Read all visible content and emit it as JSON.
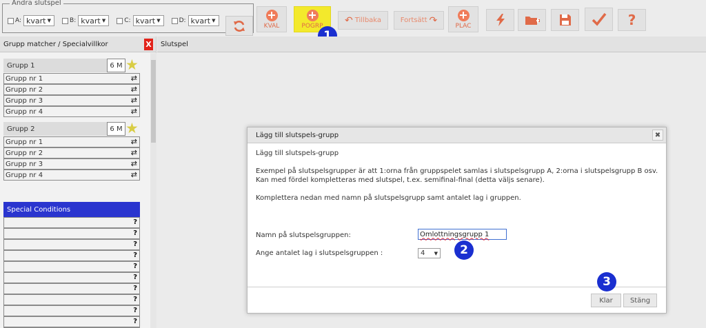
{
  "toolbar": {
    "legend": "Ändra slutspel",
    "slots": [
      {
        "letter": "A:",
        "value": "kvart"
      },
      {
        "letter": "B:",
        "value": "kvart"
      },
      {
        "letter": "C:",
        "value": "kvart"
      },
      {
        "letter": "D:",
        "value": "kvart"
      }
    ],
    "kval_label": "KVAL",
    "pogrp_label": "POGRP",
    "back_label": "Tillbaka",
    "forward_label": "Fortsätt",
    "plac_label": "PLAC",
    "accent_color": "#f07c5a",
    "highlight_color": "#f3e92c"
  },
  "callouts": [
    "1",
    "2",
    "3"
  ],
  "left_panel": {
    "title": "Grupp matcher / Specialvillkor",
    "close_label": "X",
    "groups": [
      {
        "name": "Grupp 1",
        "count": "6 M",
        "rows": [
          "Grupp nr 1",
          "Grupp nr 2",
          "Grupp nr 3",
          "Grupp nr 4"
        ]
      },
      {
        "name": "Grupp 2",
        "count": "6 M",
        "rows": [
          "Grupp nr 1",
          "Grupp nr 2",
          "Grupp nr 3",
          "Grupp nr 4"
        ]
      }
    ],
    "special_title": "Special Conditions",
    "special_rows": [
      "?",
      "?",
      "?",
      "?",
      "?",
      "?",
      "?",
      "?",
      "?",
      "?",
      "?"
    ]
  },
  "main": {
    "title": "Slutspel"
  },
  "dialog": {
    "title": "Lägg till slutspels-grupp",
    "close_label": "✖",
    "subtitle": "Lägg till slutspels-grupp",
    "paragraph1": "Exempel på slutspelsgrupper är att 1:orna från gruppspelet samlas i slutspelsgrupp A, 2:orna i slutspelsgrupp B osv. Kan med fördel kompletteras med slutspel, t.ex. semifinal-final (detta väljs senare).",
    "paragraph2": "Komplettera nedan med namn på slutspelsgrupp samt antalet lag i gruppen.",
    "name_label": "Namn på slutspelsgruppen:",
    "name_value": "Omlottningsgrupp 1",
    "count_label": "Ange antalet lag i slutspelsgruppen :",
    "count_value": "4",
    "ok_label": "Klar",
    "close_button_label": "Stäng"
  }
}
